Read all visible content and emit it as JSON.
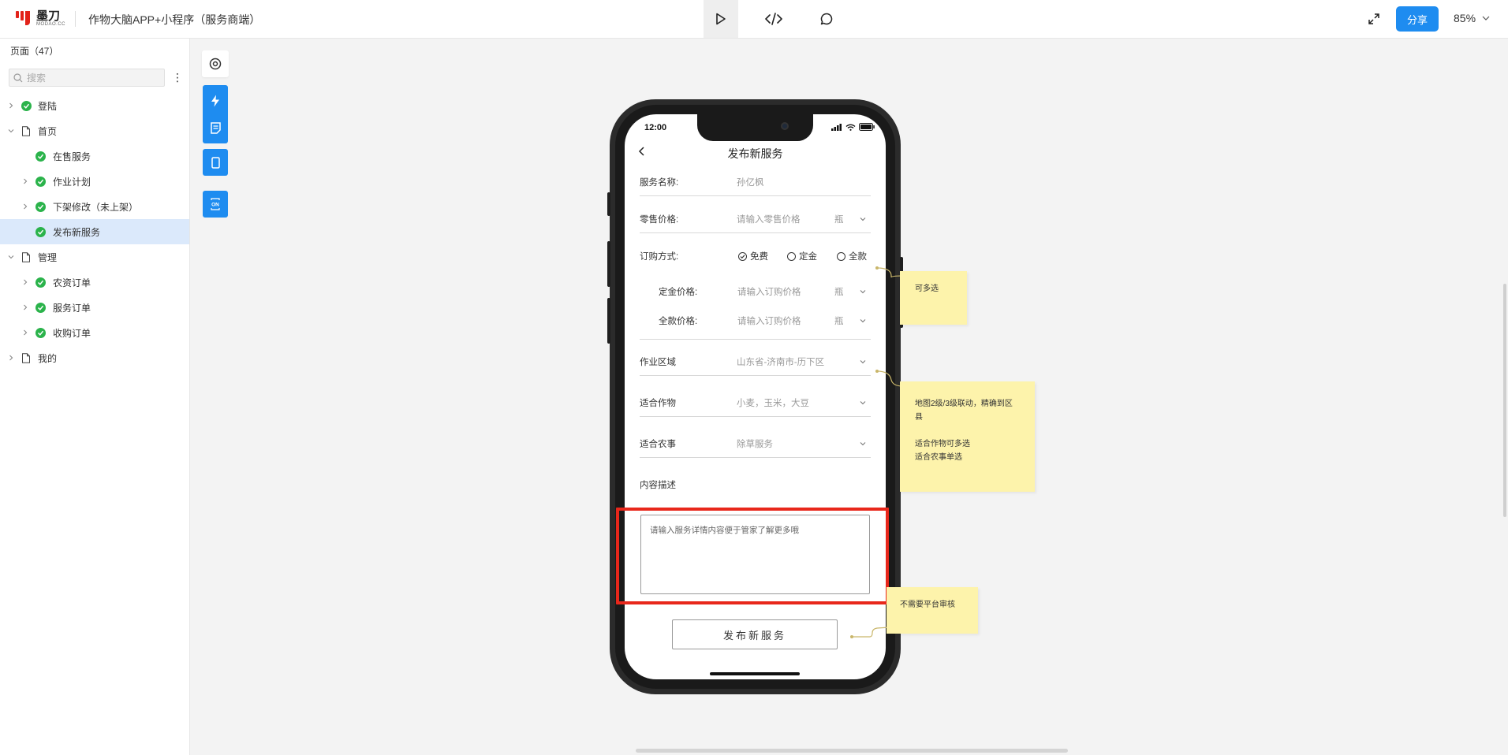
{
  "app": {
    "logo_text": "墨刀",
    "logo_sub": "MODAO.CC",
    "project_title": "作物大脑APP+小程序（服务商端）",
    "share_label": "分享",
    "zoom": "85%"
  },
  "icons": {
    "play": "play-icon",
    "code": "code-icon",
    "comment": "comment-icon",
    "expand": "expand-icon"
  },
  "sidebar": {
    "header": "页面（47）",
    "search_placeholder": "搜索",
    "items": [
      {
        "label": "登陆",
        "level": 0,
        "expandable": true,
        "status": "done"
      },
      {
        "label": "首页",
        "level": 0,
        "expandable": true,
        "status": "page"
      },
      {
        "label": "在售服务",
        "level": 1,
        "expandable": false,
        "status": "done"
      },
      {
        "label": "作业计划",
        "level": 1,
        "expandable": true,
        "status": "done"
      },
      {
        "label": "下架修改（未上架）",
        "level": 1,
        "expandable": true,
        "status": "done"
      },
      {
        "label": "发布新服务",
        "level": 1,
        "expandable": false,
        "status": "done",
        "selected": true
      },
      {
        "label": "管理",
        "level": 0,
        "expandable": true,
        "status": "page"
      },
      {
        "label": "农资订单",
        "level": 1,
        "expandable": true,
        "status": "done"
      },
      {
        "label": "服务订单",
        "level": 1,
        "expandable": true,
        "status": "done"
      },
      {
        "label": "收购订单",
        "level": 1,
        "expandable": true,
        "status": "done"
      },
      {
        "label": "我的",
        "level": 0,
        "expandable": true,
        "status": "page"
      }
    ]
  },
  "phone": {
    "time": "12:00",
    "title": "发布新服务",
    "service_name_label": "服务名称:",
    "service_name_value": "孙亿枫",
    "retail_price_label": "零售价格:",
    "retail_price_placeholder": "请输入零售价格",
    "unit": "瓶",
    "order_method_label": "订购方式:",
    "order_options": [
      "免费",
      "定金",
      "全款"
    ],
    "deposit_price_label": "定金价格:",
    "deposit_price_placeholder": "请输入订购价格",
    "full_price_label": "全款价格:",
    "full_price_placeholder": "请输入订购价格",
    "work_area_label": "作业区域",
    "work_area_value": "山东省-济南市-历下区",
    "crops_label": "适合作物",
    "crops_value": "小麦，玉米，大豆",
    "farming_label": "适合农事",
    "farming_value": "除草服务",
    "desc_label": "内容描述",
    "desc_placeholder": "请输入服务详情内容便于管家了解更多哦",
    "publish_button": "发布新服务"
  },
  "notes": {
    "note1": "可多选",
    "note2_line1": "地图2级/3级联动，精确到区",
    "note2_line2": "县",
    "note2_line3": "适合作物可多选",
    "note2_line4": "适合农事单选",
    "note3": "不需要平台审核"
  },
  "colors": {
    "accent": "#1e8cf0",
    "check": "#2bb34b",
    "selected_bg": "#dbe9fb",
    "highlight": "#e8271b",
    "note": "#fdf3ab"
  }
}
